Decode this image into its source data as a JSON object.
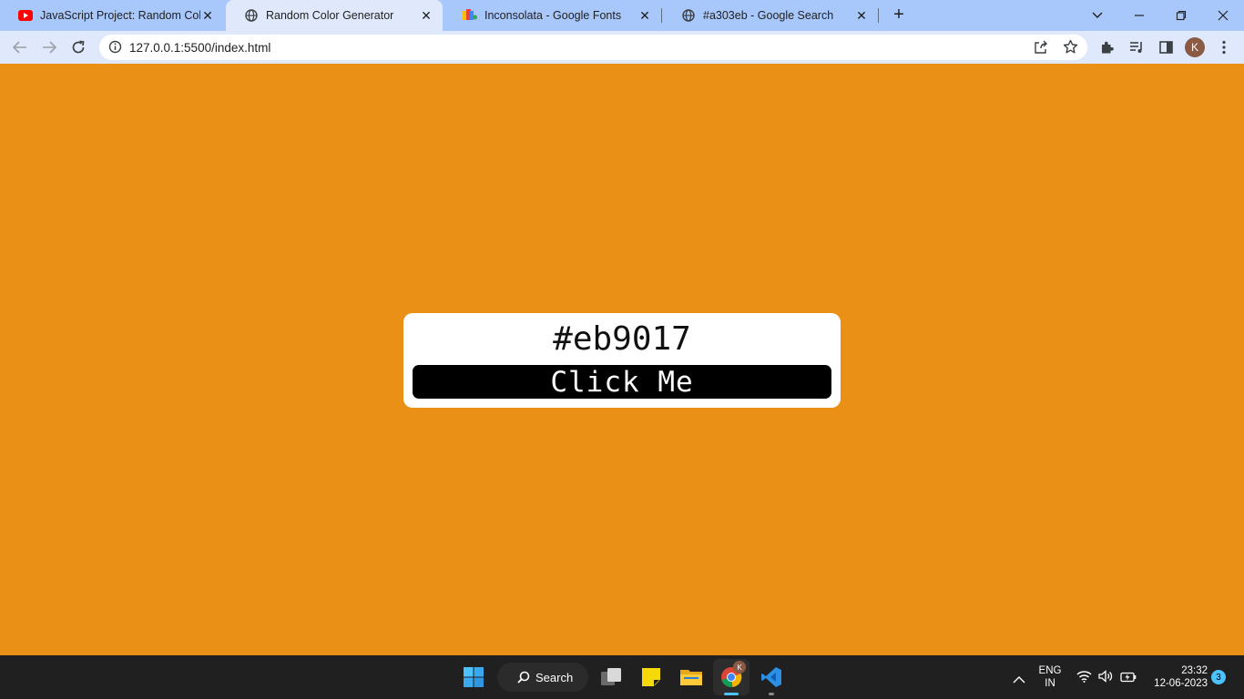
{
  "browser": {
    "tabs": [
      {
        "title": "JavaScript Project: Random Color Generator",
        "icon": "youtube-icon"
      },
      {
        "title": "Random Color Generator",
        "icon": "globe-icon",
        "active": true
      },
      {
        "title": "Inconsolata - Google Fonts",
        "icon": "google-fonts-icon"
      },
      {
        "title": "#a303eb - Google Search",
        "icon": "globe-icon"
      }
    ],
    "url": "127.0.0.1:5500/index.html",
    "profile_initial": "K"
  },
  "page": {
    "background_color": "#eb9017",
    "color_code": "#eb9017",
    "button_label": "Click Me"
  },
  "taskbar": {
    "search_label": "Search",
    "language_line1": "ENG",
    "language_line2": "IN",
    "time": "23:32",
    "date": "12-06-2023",
    "notification_count": "3",
    "chrome_profile_badge": "K"
  },
  "colors": {
    "tabstrip": "#a8c7fa",
    "toolbar": "#dfe9fb",
    "taskbar": "#202020",
    "accent": "#4cc2ff"
  }
}
